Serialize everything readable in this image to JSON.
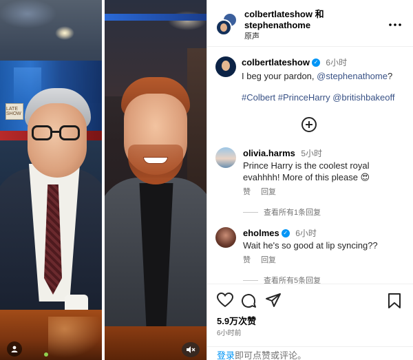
{
  "header": {
    "user1": "colbertlateshow",
    "conjunction": "和",
    "user2": "stephenathome",
    "audio": "原声"
  },
  "caption": {
    "username": "colbertlateshow",
    "time": "6小时",
    "text_prefix": "I beg your pardon, ",
    "mention": "@stephenathome",
    "text_suffix": "?",
    "hashtags": "#Colbert #PrinceHarry @britishbakeoff"
  },
  "comments": [
    {
      "username": "olivia.harms",
      "time": "5小时",
      "text": "Prince Harry is the coolest royal evahhhh! More of this please 😍",
      "like_label": "赞",
      "reply_label": "回复",
      "view_replies": "查看所有1条回复"
    },
    {
      "username": "eholmes",
      "time": "6小时",
      "text": "Wait he's so good at lip syncing??",
      "like_label": "赞",
      "reply_label": "回复",
      "view_replies": "查看所有5条回复"
    }
  ],
  "post": {
    "likes": "5.9万次赞",
    "time_ago": "6小时前"
  },
  "login": {
    "link": "登录",
    "rest": "即可点赞或评论。"
  },
  "photo_left": {
    "tag_text": "LATE SHOW"
  },
  "icons": [
    "more-icon",
    "add-comment-icon",
    "verified-icon",
    "heart-icon",
    "comment-icon",
    "share-icon",
    "bookmark-icon",
    "person-icon",
    "mute-icon"
  ],
  "colors": {
    "link": "#0095f6",
    "hashtag": "#385185",
    "verified": "#0095f6",
    "secondary_text": "#737373"
  }
}
